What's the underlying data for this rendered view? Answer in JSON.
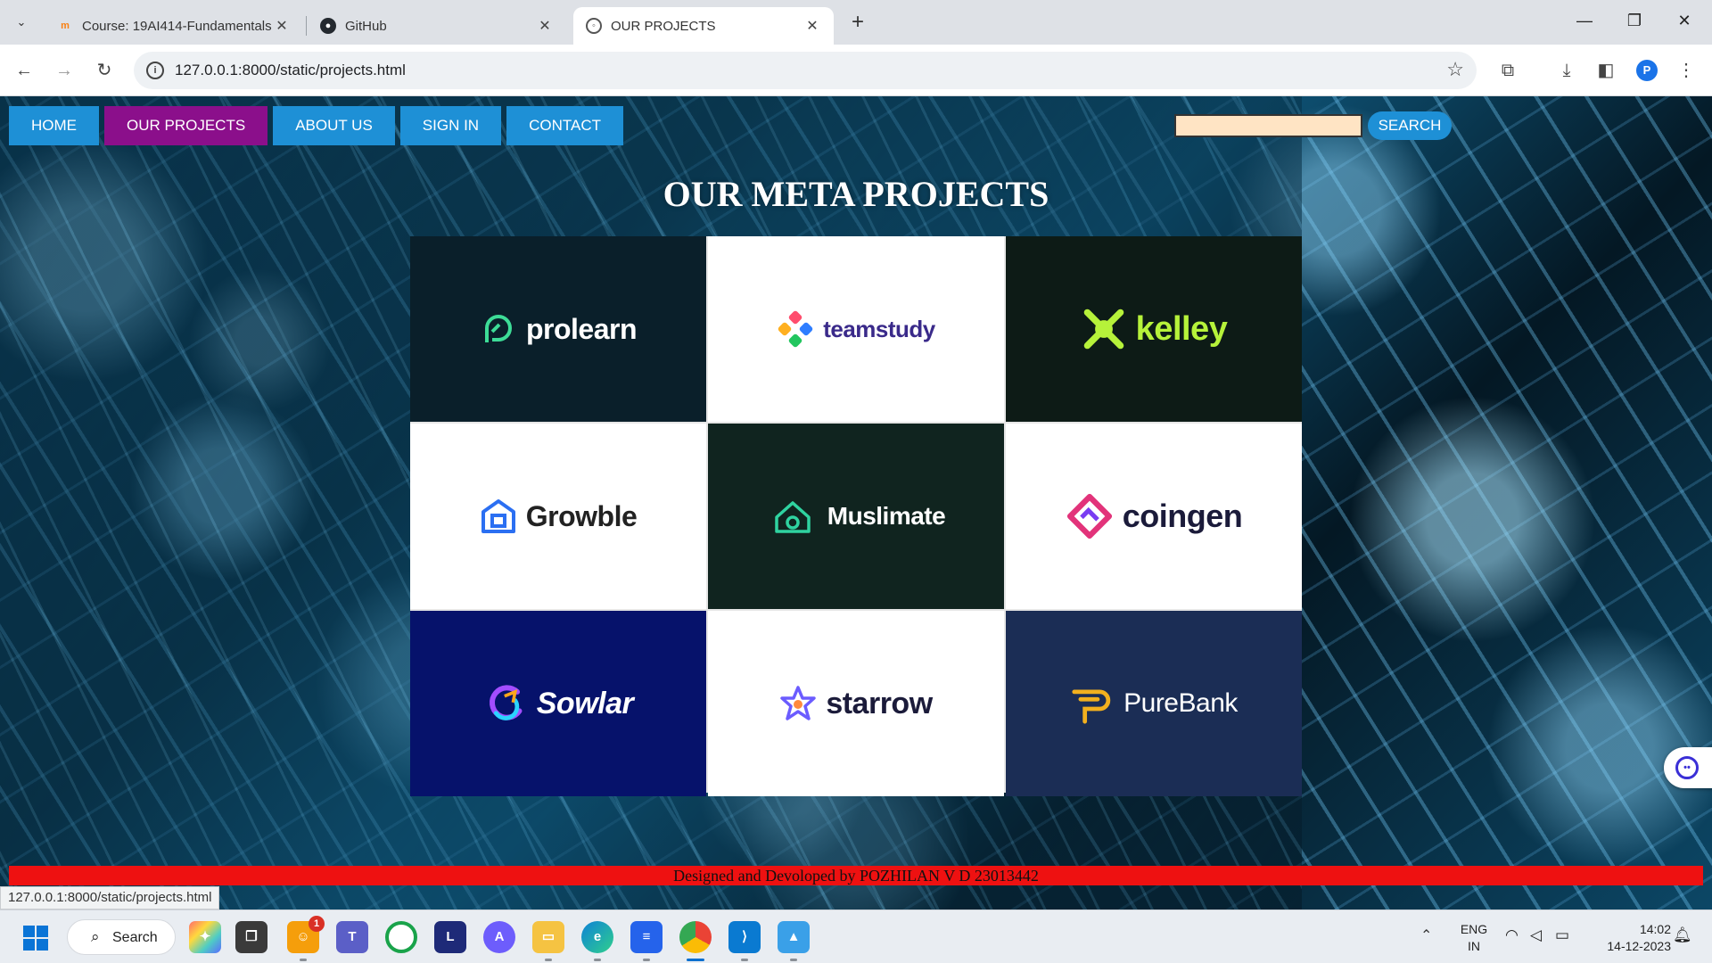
{
  "browser": {
    "tabs": [
      {
        "title": "Course: 19AI414-Fundamentals",
        "icon": "moodle-icon",
        "active": false
      },
      {
        "title": "GitHub",
        "icon": "github-icon",
        "active": false
      },
      {
        "title": "OUR PROJECTS",
        "icon": "globe-icon",
        "active": true
      }
    ],
    "url": "127.0.0.1:8000/static/projects.html",
    "profile_initial": "P"
  },
  "page": {
    "nav": [
      "HOME",
      "OUR PROJECTS",
      "ABOUT US",
      "SIGN IN",
      "CONTACT"
    ],
    "active_nav": "OUR PROJECTS",
    "search": {
      "value": "",
      "button": "SEARCH"
    },
    "heading": "OUR META PROJECTS",
    "projects": [
      {
        "name": "prolearn",
        "bg": "#0a1f2a",
        "color": "#ffffff",
        "accent": "#3ddc97"
      },
      {
        "name": "teamstudy",
        "bg": "#ffffff",
        "color": "#3a2a8a",
        "accent": "#ff4d6d"
      },
      {
        "name": "kelley",
        "bg": "#0d1b16",
        "color": "#b6f23a",
        "accent": "#b6f23a"
      },
      {
        "name": "Growble",
        "bg": "#ffffff",
        "color": "#222222",
        "accent": "#2b6ff2"
      },
      {
        "name": "Muslimate",
        "bg": "#10241f",
        "color": "#ffffff",
        "accent": "#2fd3a0"
      },
      {
        "name": "coingen",
        "bg": "#ffffff",
        "color": "#1b1b3a",
        "accent": "#e2337a"
      },
      {
        "name": "Sowlar",
        "bg": "#06126b",
        "color": "#ffffff",
        "accent": "#a34dff"
      },
      {
        "name": "starrow",
        "bg": "#ffffff",
        "color": "#1b1b3a",
        "accent": "#6b5cff"
      },
      {
        "name": "PureBank",
        "bg": "#1b2d55",
        "color": "#ffffff",
        "accent": "#f2b01e"
      }
    ],
    "footer": "Designed and Devoloped by POZHILAN V D 23013442",
    "status_url": "127.0.0.1:8000/static/projects.html"
  },
  "taskbar": {
    "search_label": "Search",
    "notification_count": "1",
    "lang": "ENG",
    "region": "IN",
    "time": "14:02",
    "date": "14-12-2023"
  }
}
